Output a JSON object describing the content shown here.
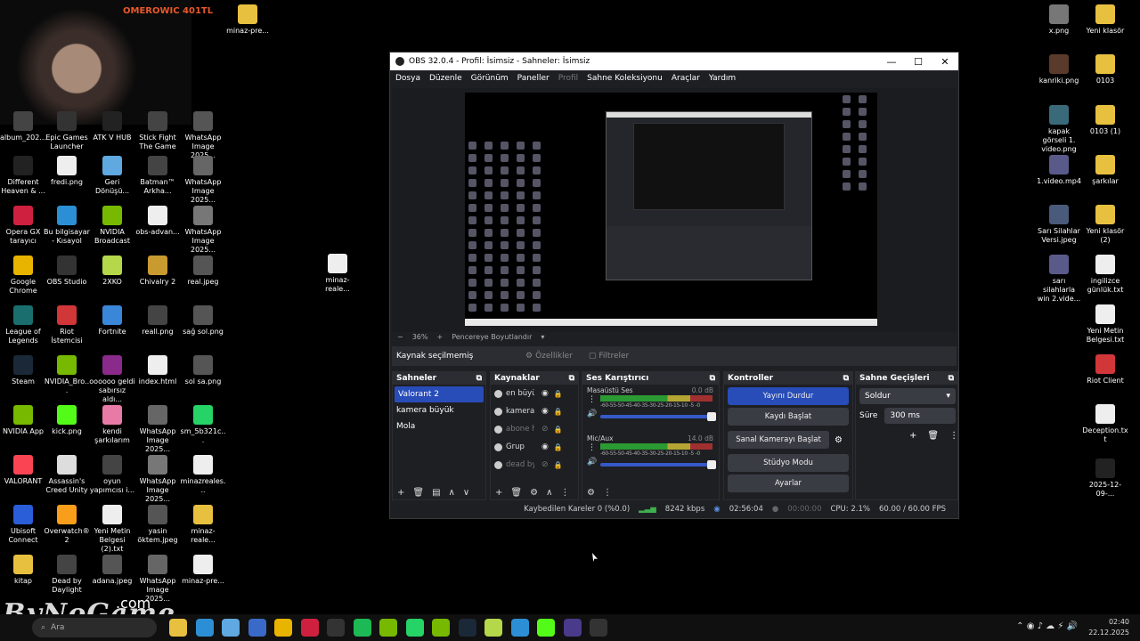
{
  "streamer": {
    "name": "OMEROWIC 401TL"
  },
  "watermark": {
    "main": "ByNoGame",
    "sub": ".com"
  },
  "desktop_left": [
    {
      "label": "album_202...",
      "color": "#444"
    },
    {
      "label": "Epic Games Launcher",
      "color": "#333"
    },
    {
      "label": "ATK V HUB",
      "color": "#222"
    },
    {
      "label": "Stick Fight The Game",
      "color": "#444"
    },
    {
      "label": "WhatsApp Image 2025...",
      "color": "#555"
    },
    {
      "label": "Different Heaven & ...",
      "color": "#222"
    },
    {
      "label": "fredi.png",
      "color": "#eee"
    },
    {
      "label": "Geri Dönüşü...",
      "color": "#5fa8e0"
    },
    {
      "label": "Batman™ Arkha...",
      "color": "#444"
    },
    {
      "label": "WhatsApp Image 2025...",
      "color": "#666"
    },
    {
      "label": "Opera GX tarayıcı",
      "color": "#d02040"
    },
    {
      "label": "Bu bilgisayar - Kısayol",
      "color": "#2c8fd6"
    },
    {
      "label": "NVIDIA Broadcast",
      "color": "#76b900"
    },
    {
      "label": "obs-advan...",
      "color": "#eee"
    },
    {
      "label": "WhatsApp Image 2025...",
      "color": "#777"
    },
    {
      "label": "Google Chrome",
      "color": "#e8b400"
    },
    {
      "label": "OBS Studio",
      "color": "#333"
    },
    {
      "label": "2XKO",
      "color": "#b4d84a"
    },
    {
      "label": "Chivalry 2",
      "color": "#c89a30"
    },
    {
      "label": "real.jpeg",
      "color": "#555"
    },
    {
      "label": "League of Legends",
      "color": "#1b6e6e"
    },
    {
      "label": "Riot İstemcisi",
      "color": "#d13639"
    },
    {
      "label": "Fortnite",
      "color": "#3a86d8"
    },
    {
      "label": "reall.png",
      "color": "#444"
    },
    {
      "label": "sağ sol.png",
      "color": "#555"
    },
    {
      "label": "Steam",
      "color": "#1b2838"
    },
    {
      "label": "NVIDIA_Bro...",
      "color": "#76b900"
    },
    {
      "label": "oooooo geldi sabırsız aldı...",
      "color": "#8a2a8a"
    },
    {
      "label": "index.html",
      "color": "#eee"
    },
    {
      "label": "sol sa.png",
      "color": "#555"
    },
    {
      "label": "NVIDIA App",
      "color": "#76b900"
    },
    {
      "label": "kick.png",
      "color": "#53fc18"
    },
    {
      "label": "kendi şarkılarım",
      "color": "#e87aa8"
    },
    {
      "label": "WhatsApp Image 2025...",
      "color": "#666"
    },
    {
      "label": "sm_5b321c...",
      "color": "#25d366"
    },
    {
      "label": "VALORANT",
      "color": "#fa4454"
    },
    {
      "label": "Assassin's Creed Unity",
      "color": "#ddd"
    },
    {
      "label": "oyun yapımcısı i...",
      "color": "#444"
    },
    {
      "label": "WhatsApp Image 2025...",
      "color": "#777"
    },
    {
      "label": "minazreales...",
      "color": "#eee"
    },
    {
      "label": "Ubisoft Connect",
      "color": "#2a5dd8"
    },
    {
      "label": "Overwatch® 2",
      "color": "#f99e1a"
    },
    {
      "label": "Yeni Metin Belgesi (2).txt",
      "color": "#eee"
    },
    {
      "label": "yasin öktem.jpeg",
      "color": "#555"
    },
    {
      "label": "minaz-reale...",
      "color": "#e8c040"
    },
    {
      "label": "kitap",
      "color": "#e8c040"
    },
    {
      "label": "Dead by Daylight",
      "color": "#444"
    },
    {
      "label": "adana.jpeg",
      "color": "#555"
    },
    {
      "label": "WhatsApp Image 2025...",
      "color": "#666"
    },
    {
      "label": "minaz-pre...",
      "color": "#eee"
    }
  ],
  "desktop_mid": [
    {
      "label": "minaz-pre...",
      "color": "#e8c040"
    },
    {
      "label": "minaz-reale...",
      "color": "#eee"
    }
  ],
  "desktop_right": [
    {
      "label": "x.png",
      "color": "#777"
    },
    {
      "label": "Yeni klasör",
      "color": "#e8c040"
    },
    {
      "label": "kanriki.png",
      "color": "#5a3a2a"
    },
    {
      "label": "0103",
      "color": "#e8c040"
    },
    {
      "label": "kapak görseli 1. video.png",
      "color": "#3a6a7a"
    },
    {
      "label": "0103 (1)",
      "color": "#e8c040"
    },
    {
      "label": "1.video.mp4",
      "color": "#5a5a8a"
    },
    {
      "label": "şarkılar",
      "color": "#e8c040"
    },
    {
      "label": "Sarı Silahlar Versi.jpeg",
      "color": "#4a5a7a"
    },
    {
      "label": "Yeni klasör (2)",
      "color": "#e8c040"
    },
    {
      "label": "sarı silahlarla win 2.vide...",
      "color": "#5a5a8a"
    },
    {
      "label": "ingilizce günlük.txt",
      "color": "#eee"
    },
    {
      "label": "Yeni Metin Belgesi.txt",
      "color": "#eee"
    },
    {
      "label": "Riot Client",
      "color": "#d13639"
    },
    {
      "label": "Deception.txt",
      "color": "#eee"
    },
    {
      "label": "2025-12-09-...",
      "color": "#222"
    }
  ],
  "obs": {
    "title": "OBS 32.0.4 - Profil: İsimsiz - Sahneler: İsimsiz",
    "menu": [
      "Dosya",
      "Düzenle",
      "Görünüm",
      "Paneller",
      "Profil",
      "Sahne Koleksiyonu",
      "Araçlar",
      "Yardım"
    ],
    "zoom": "36%",
    "zoom_minus": "−",
    "zoom_plus": "+",
    "resize_label": "Pencereye Boyutlandır",
    "no_source": "Kaynak seçilmemiş",
    "properties": "Özellikler",
    "filters": "Filtreler",
    "docks": {
      "scenes_title": "Sahneler",
      "sources_title": "Kaynaklar",
      "mixer_title": "Ses Karıştırıcı",
      "controls_title": "Kontroller",
      "transitions_title": "Sahne Geçişleri"
    },
    "scenes": [
      "Valorant 2",
      "kamera büyük",
      "Mola"
    ],
    "sources": [
      {
        "name": "en büyük",
        "dim": false
      },
      {
        "name": "kamera",
        "dim": false
      },
      {
        "name": "abone h",
        "dim": true
      },
      {
        "name": "Grup",
        "dim": false
      },
      {
        "name": "dead by",
        "dim": true
      }
    ],
    "mixer": [
      {
        "name": "Masaüstü Ses",
        "db": "0.0 dB"
      },
      {
        "name": "Mic/Aux",
        "db": "14.0 dB"
      }
    ],
    "meter_scale": "-60-55-50-45-40-35-30-25-20-15-10 -5 -0",
    "controls": {
      "stop_stream": "Yayını Durdur",
      "start_record": "Kaydı Başlat",
      "virtual_cam": "Sanal Kamerayı Başlat",
      "studio_mode": "Stüdyo Modu",
      "settings": "Ayarlar"
    },
    "transition": {
      "selected": "Soldur",
      "duration_label": "Süre",
      "duration": "300 ms"
    },
    "status": {
      "dropped": "Kaybedilen Kareler 0 (%0.0)",
      "bitrate": "8242 kbps",
      "stream_time": "02:56:04",
      "record_time": "00:00:00",
      "cpu": "CPU: 2.1%",
      "fps": "60.00 / 60.00 FPS"
    },
    "accent": "#284cb8"
  },
  "taskbar": {
    "search_placeholder": "Ara",
    "time": "02:40",
    "date": "22.12.2025",
    "apps": [
      "#e8c040",
      "#2c8fd6",
      "#5fa8e0",
      "#3a6ac8",
      "#e8b400",
      "#d02040",
      "#333",
      "#1db954",
      "#76b900",
      "#25d366",
      "#76b900",
      "#1b2838",
      "#b4d84a",
      "#2c8fd6",
      "#53fc18",
      "#4a3a8a",
      "#333"
    ]
  }
}
